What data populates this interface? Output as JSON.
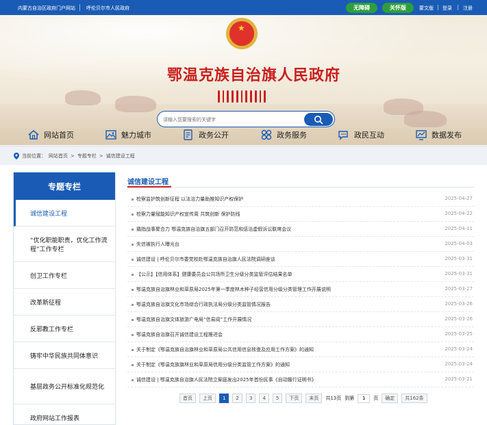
{
  "topbar": {
    "left_link_1": "内蒙古自治区政府门户网站",
    "left_link_2": "呼伦贝尔市人民政府",
    "btn_accessible": "无障碍",
    "btn_care": "关怀版",
    "link_mongol": "蒙文版",
    "link_login": "登录",
    "link_register": "注册"
  },
  "banner": {
    "site_title": "鄂温克族自治旗人民政府",
    "search_placeholder": "请输入您要搜索的关键字"
  },
  "nav": {
    "items": [
      {
        "label": "网站首页",
        "icon": "home-icon"
      },
      {
        "label": "魅力城市",
        "icon": "image-icon"
      },
      {
        "label": "政务公开",
        "icon": "document-icon"
      },
      {
        "label": "政务服务",
        "icon": "grid-icon"
      },
      {
        "label": "政民互动",
        "icon": "chat-icon"
      },
      {
        "label": "数据发布",
        "icon": "chart-icon"
      }
    ]
  },
  "breadcrumb": {
    "label": "当前位置：",
    "items": [
      "网站首页",
      "专题专栏",
      "诚信建设工程"
    ],
    "separator": ">"
  },
  "sidebar": {
    "title": "专题专栏",
    "items": [
      "诚信建设工程",
      "“优化职能职责，优化工作流程”工作专栏",
      "创卫工作专栏",
      "改革新征程",
      "反邪教工作专栏",
      "铸牢中华民族共同体意识",
      "基层政务公开标准化规范化",
      "政府网站工作报表"
    ]
  },
  "main": {
    "title": "诚信建设工程",
    "list": [
      {
        "title": "检察监护筑创新征程 以法治力量助推知识产权保护",
        "date": "2025-04-27"
      },
      {
        "title": "检察力量赋能知识产权宣传周 共筑创新 保护防线",
        "date": "2025-04-22"
      },
      {
        "title": "撬指战事聚合力 鄂温克族自治旗五部门召开防范和惩治虚假诉讼联席会议",
        "date": "2025-04-11"
      },
      {
        "title": "失信被执行人曝光台",
        "date": "2025-04-03"
      },
      {
        "title": "诚信建设 | 呼伦贝尔市委党校赴鄂温克族自治旗人民法院调研座谈",
        "date": "2025-03-31"
      },
      {
        "title": "【公示】【信用体系】健康委员会公共场所卫生分级分类监管评估结果名单",
        "date": "2025-03-31"
      },
      {
        "title": "鄂温克族自治旗林业和草原局2025年第一季度林木种子经营信用分级分类管理工作开展说明",
        "date": "2025-03-27"
      },
      {
        "title": "鄂温克族自治旗文化市场综合行政执法局分级分类监管情况报告",
        "date": "2025-03-26"
      },
      {
        "title": "鄂温克族自治旗文体旅游广电局“信易阅”工作开展情况",
        "date": "2025-03-26"
      },
      {
        "title": "鄂温克族自治旗召开诚信建设工程推进会",
        "date": "2025-03-25"
      },
      {
        "title": "关于制定《鄂温克族自治旗林业和草原局公共信用信息核查及应用工作方案》的通知",
        "date": "2025-03-24"
      },
      {
        "title": "关于制定《鄂温克族旗林业和草原局信用分级分类监管工作方案》的通知",
        "date": "2025-03-24"
      },
      {
        "title": "诚信建设 | 鄂温克族自治旗人民法院立案庭发出2025年首份民事《自动履行证明书》",
        "date": "2025-03-21"
      }
    ]
  },
  "pager": {
    "first": "首页",
    "prev": "上页",
    "pages": [
      "1",
      "2",
      "3",
      "4",
      "5"
    ],
    "current": "1",
    "next": "下页",
    "last": "末页",
    "total_pages": "共13页",
    "goto_label": "到第",
    "goto_value": "1",
    "goto_unit": "页",
    "confirm": "确定",
    "total_items": "共162条"
  }
}
